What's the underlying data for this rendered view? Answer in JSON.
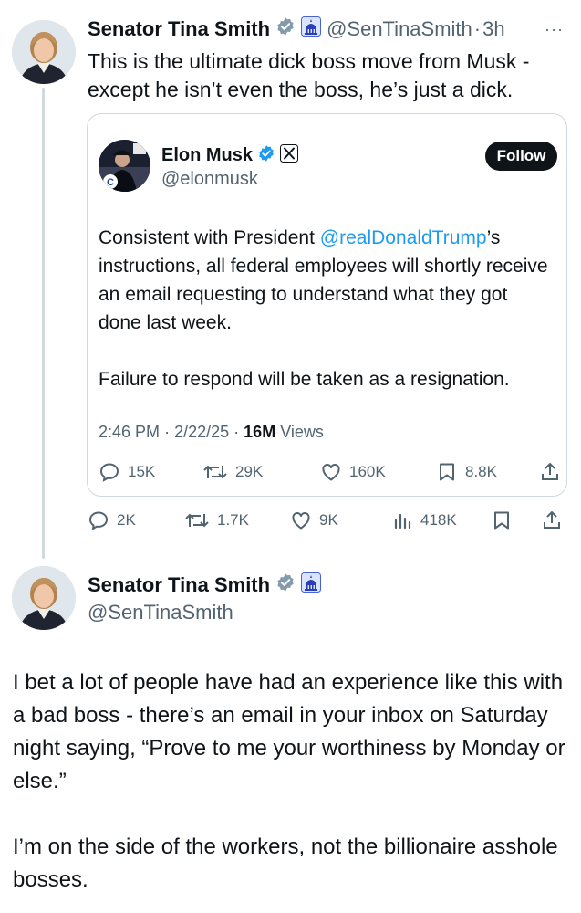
{
  "tweet1": {
    "name": "Senator Tina Smith",
    "handle": "@SenTinaSmith",
    "separator": "·",
    "time": "3h",
    "more": "···",
    "text": "This is the ultimate dick boss move from Musk - except he isn’t even the boss, he’s just a dick.",
    "actions": {
      "replies": "2K",
      "reposts": "1.7K",
      "likes": "9K",
      "views": "418K"
    }
  },
  "quote": {
    "name": "Elon Musk",
    "handle": "@elonmusk",
    "follow_label": "Follow",
    "text_prefix": "Consistent with President ",
    "mention": "@realDonaldTrump",
    "text_suffix": "’s instructions, all federal employees will shortly receive an email requesting to understand what they got done last week.",
    "text_para2": "Failure to respond will be taken as a resignation.",
    "meta_time": "2:46 PM",
    "meta_date": "2/22/25",
    "meta_views_count": "16M",
    "meta_views_label": "Views",
    "meta_separator": "·",
    "actions": {
      "replies": "15K",
      "reposts": "29K",
      "likes": "160K",
      "bookmarks": "8.8K"
    }
  },
  "tweet2": {
    "name": "Senator Tina Smith",
    "handle": "@SenTinaSmith",
    "para1": "I bet a lot of people have had an experience like this with a bad boss - there’s an email in your inbox on Saturday night saying, “Prove to me your worthiness by Monday or else.”",
    "para2": "I’m on the side of the workers, not the billionaire asshole bosses."
  },
  "colors": {
    "text": "#0f1419",
    "secondary": "#536471",
    "link": "#1d9bf0",
    "border": "#cfd9de",
    "verified_gray": "#829aab",
    "verified_blue": "#1d9bf0"
  },
  "icons": [
    "verified-gray-badge-icon",
    "government-building-icon",
    "verified-blue-badge-icon",
    "x-logo-icon",
    "reply-icon",
    "repost-icon",
    "like-icon",
    "views-icon",
    "bookmark-icon",
    "share-icon",
    "more-icon"
  ]
}
